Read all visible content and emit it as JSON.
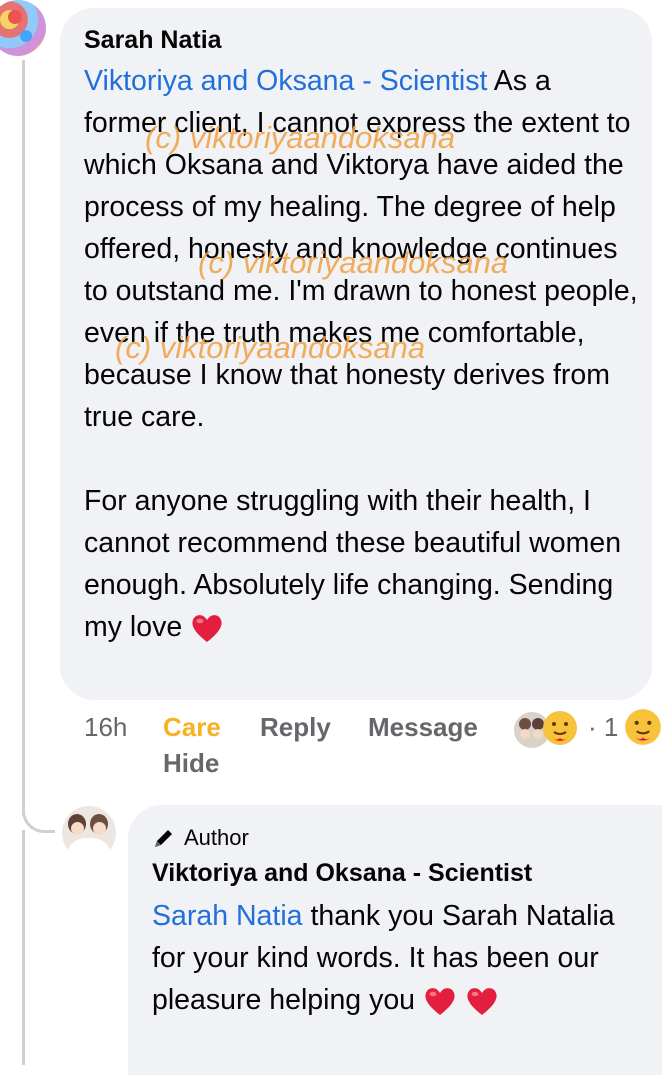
{
  "comment": {
    "author_name": "Sarah Natia",
    "mention": "Viktoriya and Oksana - Scientist",
    "para1": "As a former client, I cannot express the extent to which Oksana and Viktorya have aided the process of my healing. The degree of help offered, honesty and knowledge continues to outstand me. I'm drawn to honest people, even if the truth makes me comfortable, because I know that honesty derives from true care.",
    "para2": "For anyone struggling with their health, I cannot recommend these beautiful women enough. Absolutely life changing. Sending my love",
    "heart_icon": "red-heart-emoji",
    "time": "16h",
    "reaction_label": "Care",
    "reply_label": "Reply",
    "message_label": "Message",
    "hide_label": "Hide",
    "reaction_count": "· 1",
    "reaction_icon": "care-emoji-icon",
    "care_color": "#f7b125",
    "mention_color": "#216fdb"
  },
  "reply": {
    "badge_icon": "pencil-icon",
    "badge_label": "Author",
    "author_name": "Viktoriya and Oksana - Scientist",
    "mention": "Sarah Natia",
    "text": "thank you Sarah Natalia for your kind words. It has been our pleasure helping you",
    "heart_icon": "red-heart-emoji"
  },
  "watermark": "(c) viktoriyaandoksana"
}
